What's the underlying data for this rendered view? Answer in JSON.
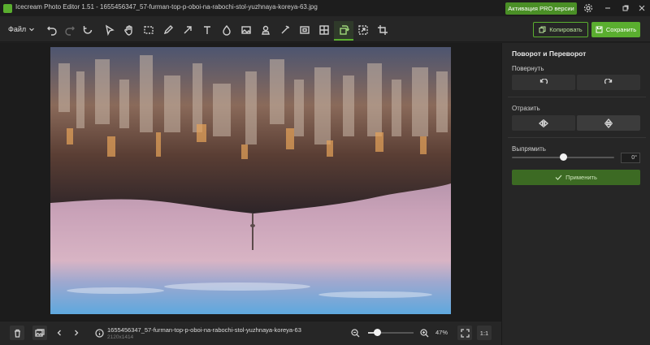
{
  "window": {
    "title": "Icecream Photo Editor 1.51 - 1655456347_57-furman-top-p-oboi-na-rabochi-stol-yuzhnaya-koreya-63.jpg",
    "pro_label": "Активация PRO версии"
  },
  "toolbar": {
    "file_menu": "Файл",
    "copy_label": "Копировать",
    "save_label": "Сохранить",
    "tools": [
      "undo-icon",
      "redo-icon",
      "reset-icon",
      "cursor-icon",
      "hand-icon",
      "select-rect-icon",
      "pen-icon",
      "arrow-icon",
      "text-icon",
      "drop-icon",
      "image-icon",
      "stamp-icon",
      "magic-wand-icon",
      "crop-frame-icon",
      "split-icon",
      "rotate-flip-icon",
      "resize-icon",
      "crop-icon"
    ]
  },
  "panel": {
    "title": "Поворот и Переворот",
    "rotate_label": "Повернуть",
    "flip_label": "Отразить",
    "straighten_label": "Выпрямить",
    "angle_value": "0°",
    "straighten_level": 0.5,
    "apply_label": "Применить"
  },
  "bottom": {
    "file_name": "1655456347_57-furman-top-p-oboi-na-rabochi-stol-yuzhnaya-koreya-63",
    "file_dims": "2120x1414",
    "zoom_level": "47%",
    "zoom_fraction": 0.2,
    "one_to_one": "1:1"
  },
  "colors": {
    "accent": "#5aae2f",
    "background": "#1f1f1f",
    "panel": "#262626"
  }
}
